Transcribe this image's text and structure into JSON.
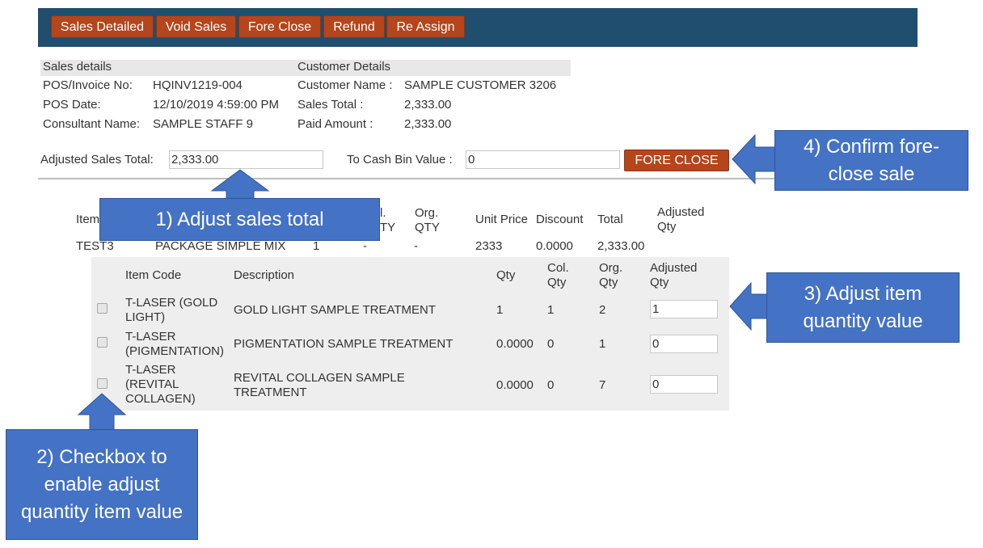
{
  "toolbar": {
    "tabs": [
      "Sales Detailed",
      "Void Sales",
      "Fore Close",
      "Refund",
      "Re Assign"
    ]
  },
  "sales_details": {
    "heading": "Sales details",
    "pos_invoice_label": "POS/Invoice No:",
    "pos_invoice_value": "HQINV1219-004",
    "pos_date_label": "POS Date:",
    "pos_date_value": "12/10/2019 4:59:00 PM",
    "consultant_label": "Consultant Name:",
    "consultant_value": "SAMPLE STAFF 9"
  },
  "customer_details": {
    "heading": "Customer Details",
    "name_label": "Customer Name :",
    "name_value": "SAMPLE CUSTOMER 3206",
    "sales_total_label": "Sales Total :",
    "sales_total_value": "2,333.00",
    "paid_label": "Paid Amount :",
    "paid_value": "2,333.00"
  },
  "adjust": {
    "adjusted_sales_total_label": "Adjusted Sales Total:",
    "adjusted_sales_total_value": "2,333.00",
    "cash_bin_label": "To Cash Bin Value :",
    "cash_bin_value": "0",
    "fore_close_button": "FORE CLOSE"
  },
  "main_table": {
    "headers": {
      "item_partial": "Item",
      "col_partial_top": "l.",
      "col_partial_bottom": "TY",
      "org_qty": "Org. QTY",
      "unit_price": "Unit Price",
      "discount": "Discount",
      "total": "Total",
      "adjusted_qty": "Adjusted Qty"
    },
    "row": {
      "item": "TEST3",
      "description": "PACKAGE SIMPLE MIX",
      "qty": "1",
      "col_qty": "-",
      "org_qty": "-",
      "unit_price": "2333",
      "discount": "0.0000",
      "total": "2,333.00"
    }
  },
  "sub_table": {
    "headers": {
      "item_code": "Item Code",
      "description": "Description",
      "qty": "Qty",
      "col_qty": "Col. Qty",
      "org_qty": "Org. Qty",
      "adjusted_qty": "Adjusted Qty"
    },
    "rows": [
      {
        "item_code": "T-LASER (GOLD LIGHT)",
        "description": "GOLD LIGHT SAMPLE TREATMENT",
        "qty": "1",
        "col_qty": "1",
        "org_qty": "2",
        "adjusted_qty": "1"
      },
      {
        "item_code": "T-LASER (PIGMENTATION)",
        "description": "PIGMENTATION SAMPLE TREATMENT",
        "qty": "0.0000",
        "col_qty": "0",
        "org_qty": "1",
        "adjusted_qty": "0"
      },
      {
        "item_code": "T-LASER (REVITAL COLLAGEN)",
        "description": "REVITAL COLLAGEN SAMPLE TREATMENT",
        "qty": "0.0000",
        "col_qty": "0",
        "org_qty": "7",
        "adjusted_qty": "0"
      }
    ]
  },
  "callouts": {
    "c1": "1) Adjust sales total",
    "c2": "2) Checkbox to enable adjust quantity item value",
    "c3": "3) Adjust item quantity value",
    "c4": "4) Confirm fore-close sale"
  },
  "colors": {
    "topbar": "#1f4e6e",
    "button": "#b5451b",
    "callout": "#4472c4"
  }
}
